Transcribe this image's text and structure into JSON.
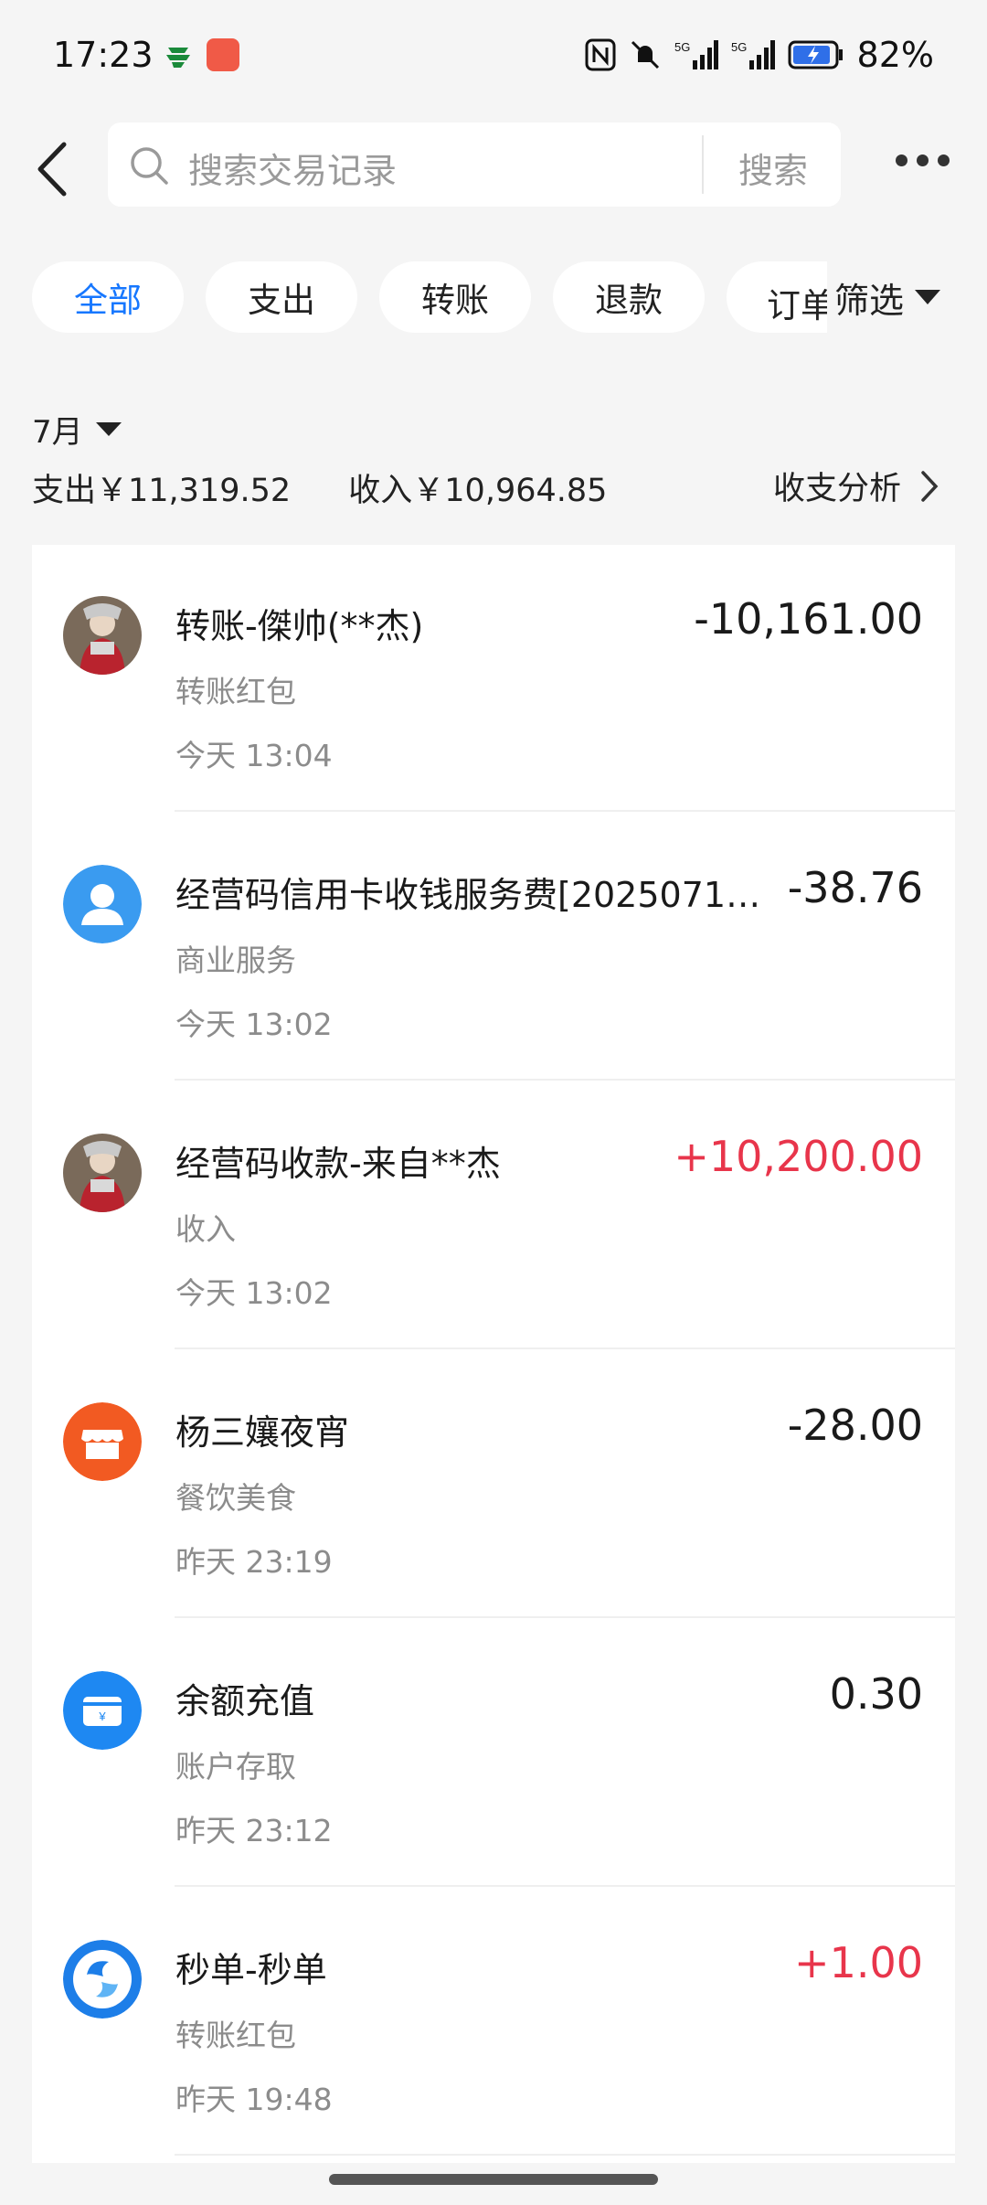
{
  "status_bar": {
    "time": "17:23",
    "battery": "82%",
    "icons": [
      "nfc-icon",
      "mute-bell-icon",
      "5g-signal-icon",
      "5g-signal-icon",
      "battery-charging-icon"
    ]
  },
  "header": {
    "search_placeholder": "搜索交易记录",
    "search_button": "搜索"
  },
  "filters": {
    "chips": [
      "全部",
      "支出",
      "转账",
      "退款",
      "订单"
    ],
    "active": "全部",
    "filter_label": "筛选"
  },
  "summary": {
    "month": "7月",
    "expense": "支出￥11,319.52",
    "income": "收入￥10,964.85",
    "analysis_label": "收支分析"
  },
  "transactions": [
    {
      "title": "转账-傑帅(**杰)",
      "category": "转账红包",
      "time": "今天 13:04",
      "amount": "-10,161.00",
      "positive": false,
      "icon": "user-photo-avatar",
      "color": "#8a6e5c"
    },
    {
      "title": "经营码信用卡收钱服务费[20250711...",
      "category": "商业服务",
      "time": "今天 13:02",
      "amount": "-38.76",
      "positive": false,
      "icon": "person-icon",
      "color": "#3a9bf0"
    },
    {
      "title": "经营码收款-来自**杰",
      "category": "收入",
      "time": "今天 13:02",
      "amount": "+10,200.00",
      "positive": true,
      "icon": "user-photo-avatar",
      "color": "#8a6e5c"
    },
    {
      "title": "杨三孃夜宵",
      "category": "餐饮美食",
      "time": "昨天 23:19",
      "amount": "-28.00",
      "positive": false,
      "icon": "store-icon",
      "color": "#f25a22"
    },
    {
      "title": "余额充值",
      "category": "账户存取",
      "time": "昨天 23:12",
      "amount": "0.30",
      "positive": false,
      "icon": "wallet-icon",
      "color": "#1e88f2"
    },
    {
      "title": "秒单-秒单",
      "category": "转账红包",
      "time": "昨天 19:48",
      "amount": "+1.00",
      "positive": true,
      "icon": "swirl-logo-icon",
      "color": "#1d7ee8"
    }
  ],
  "colors": {
    "accent": "#1677ff",
    "income": "#e8354b"
  }
}
